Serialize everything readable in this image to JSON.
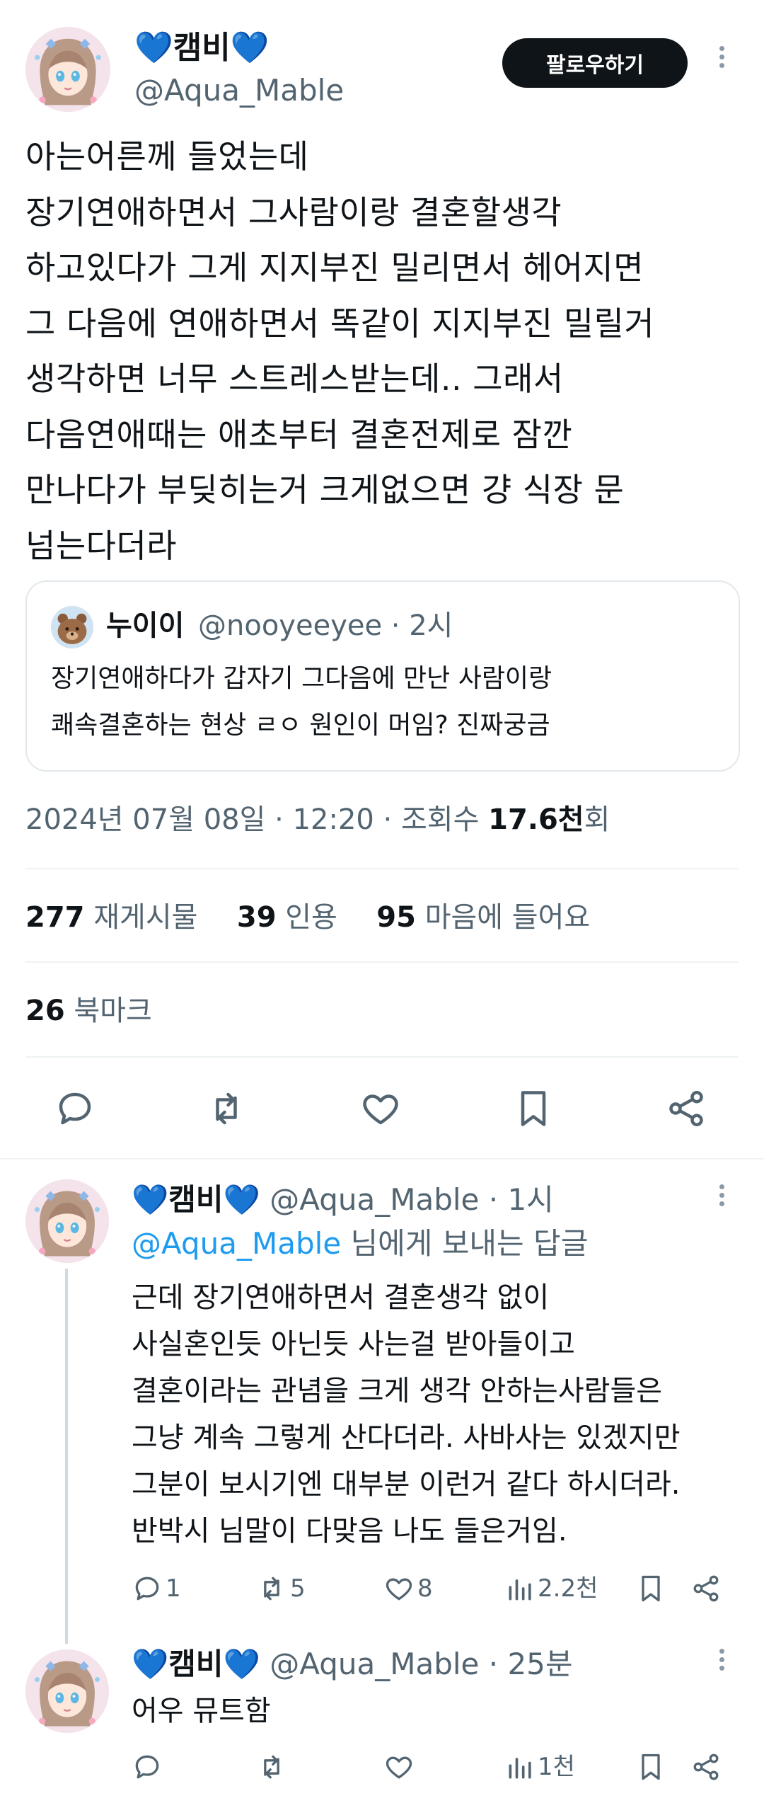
{
  "main_post": {
    "display_name": "💙캠비💙",
    "handle": "@Aqua_Mable",
    "follow_label": "팔로우하기",
    "text": "아는어른께 들었는데\n장기연애하면서 그사람이랑 결혼할생각\n하고있다가 그게 지지부진 밀리면서 헤어지면\n그 다음에 연애하면서 똑같이 지지부진 밀릴거\n생각하면 너무 스트레스받는데.. 그래서\n다음연애때는 애초부터 결혼전제로 잠깐\n만나다가 부딪히는거 크게없으면 걍 식장 문\n넘는다더라",
    "quote": {
      "name": "누이이",
      "handle_time": "@nooyeeyee · 2시",
      "text": "장기연애하다가 갑자기 그다음에 만난 사람이랑\n쾌속결혼하는 현상 ㄹㅇ 원인이 머임? 진짜궁금"
    },
    "meta_prefix": "2024년 07월 08일 · 12:20 · 조회수 ",
    "views": "17.6천",
    "views_suffix": "회",
    "stats": {
      "reposts_count": "277",
      "reposts_label": "재게시물",
      "quotes_count": "39",
      "quotes_label": "인용",
      "likes_count": "95",
      "likes_label": "마음에 들어요",
      "bookmarks_count": "26",
      "bookmarks_label": "북마크"
    }
  },
  "replies": [
    {
      "display_name": "💙캠비💙",
      "handle_time": "@Aqua_Mable · 1시",
      "reply_to_handle": "@Aqua_Mable",
      "reply_to_suffix": " 님에게 보내는 답글",
      "text": "근데 장기연애하면서 결혼생각 없이\n사실혼인듯 아닌듯 사는걸 받아들이고\n결혼이라는 관념을 크게 생각 안하는사람들은\n그냥 계속 그렇게 산다더라. 사바사는 있겠지만\n그분이 보시기엔 대부분 이런거 같다 하시더라.\n반박시 님말이 다맞음 나도 들은거임.",
      "reply_count": "1",
      "repost_count": "5",
      "like_count": "8",
      "view_count": "2.2천"
    },
    {
      "display_name": "💙캠비💙",
      "handle_time": "@Aqua_Mable · 25분",
      "text": "어우 뮤트함",
      "view_count": "1천"
    }
  ],
  "icons": [
    "reply-icon",
    "repost-icon",
    "like-icon",
    "bookmark-icon",
    "share-icon",
    "views-icon",
    "more-icon"
  ],
  "colors": {
    "text": "#0f1419",
    "secondary": "#536471",
    "link": "#1d9bf0",
    "heart": "#4fd1e8",
    "button": "#0f1419"
  }
}
